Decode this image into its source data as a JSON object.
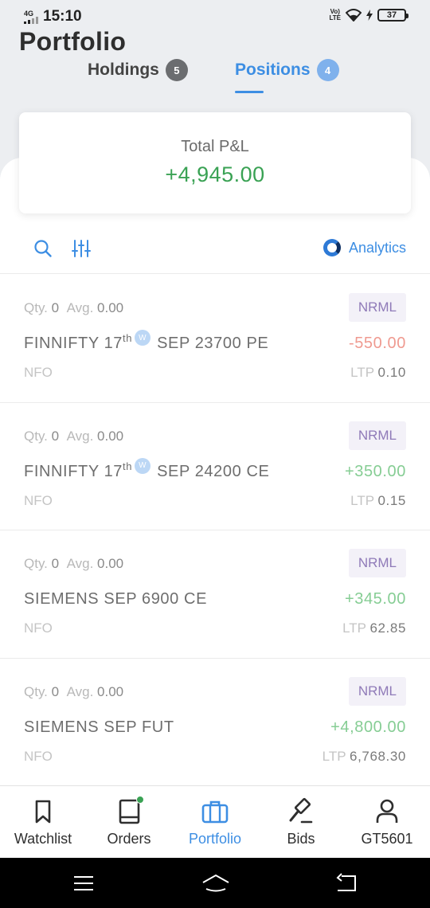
{
  "status_bar": {
    "network": "4G",
    "time": "15:10",
    "volte_line1": "Vo)",
    "volte_line2": "LTE",
    "battery": "37"
  },
  "page": {
    "title": "Portfolio"
  },
  "tabs": [
    {
      "label": "Holdings",
      "count": "5",
      "active": false
    },
    {
      "label": "Positions",
      "count": "4",
      "active": true
    }
  ],
  "pnl": {
    "label": "Total P&L",
    "value": "+4,945.00"
  },
  "toolbar": {
    "search_icon": "search-icon",
    "filter_icon": "sliders-icon",
    "analytics_label": "Analytics"
  },
  "positions": [
    {
      "qty_label": "Qty.",
      "qty": "0",
      "avg_label": "Avg.",
      "avg": "0.00",
      "product": "NRML",
      "symbol_name": "FINNIFTY 17",
      "symbol_sup": "th",
      "weekly": "W",
      "symbol_rest": "SEP 23700 PE",
      "pnl": "-550.00",
      "exchange": "NFO",
      "ltp_label": "LTP",
      "ltp": "0.10"
    },
    {
      "qty_label": "Qty.",
      "qty": "0",
      "avg_label": "Avg.",
      "avg": "0.00",
      "product": "NRML",
      "symbol_name": "FINNIFTY 17",
      "symbol_sup": "th",
      "weekly": "W",
      "symbol_rest": "SEP 24200 CE",
      "pnl": "+350.00",
      "exchange": "NFO",
      "ltp_label": "LTP",
      "ltp": "0.15"
    },
    {
      "qty_label": "Qty.",
      "qty": "0",
      "avg_label": "Avg.",
      "avg": "0.00",
      "product": "NRML",
      "symbol": "SIEMENS SEP 6900 CE",
      "pnl": "+345.00",
      "exchange": "NFO",
      "ltp_label": "LTP",
      "ltp": "62.85"
    },
    {
      "qty_label": "Qty.",
      "qty": "0",
      "avg_label": "Avg.",
      "avg": "0.00",
      "product": "NRML",
      "symbol": "SIEMENS SEP FUT",
      "pnl": "+4,800.00",
      "exchange": "NFO",
      "ltp_label": "LTP",
      "ltp": "6,768.30"
    }
  ],
  "nav": [
    {
      "label": "Watchlist",
      "icon": "bookmark-icon"
    },
    {
      "label": "Orders",
      "icon": "book-icon"
    },
    {
      "label": "Portfolio",
      "icon": "briefcase-icon",
      "active": true
    },
    {
      "label": "Bids",
      "icon": "gavel-icon"
    },
    {
      "label": "GT5601",
      "icon": "user-icon"
    }
  ],
  "colors": {
    "accent": "#3d8ee3",
    "profit": "#3aa254",
    "loss": "#ef9a90",
    "product_tag": "#8f7ab8"
  }
}
